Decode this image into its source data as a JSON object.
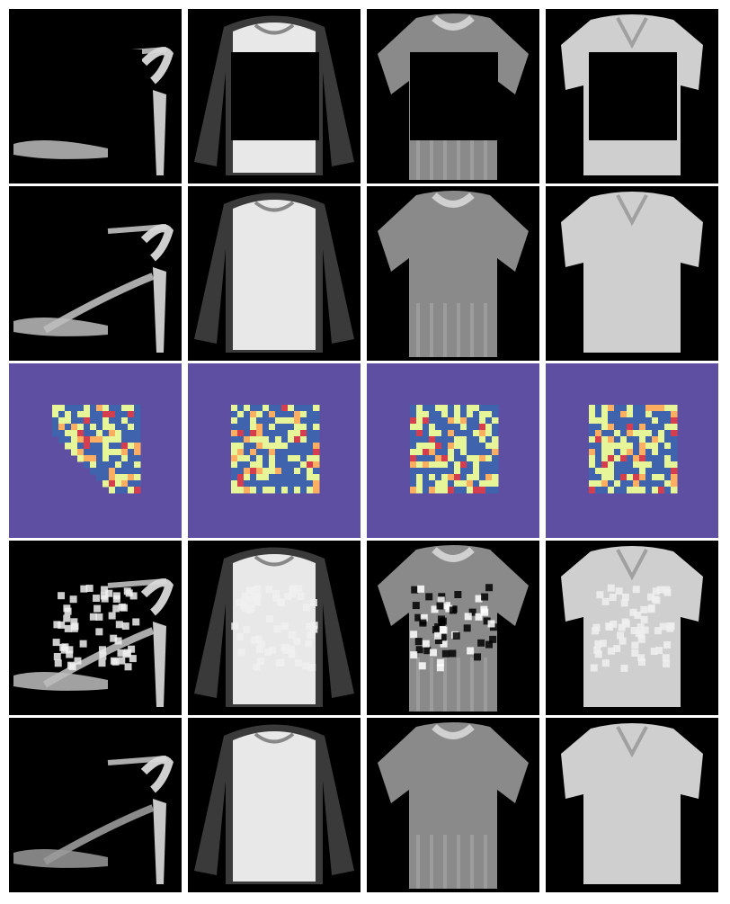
{
  "colors": {
    "background": "#000000",
    "separator": "#ffffff",
    "heatmap_background": "#5e4fa2",
    "heatmap_low": "#3f64ad",
    "heatmap_mid": "#e6f598",
    "heatmap_high": "#d53e4f"
  },
  "grid": {
    "rows": [
      {
        "kind": "masked-input",
        "cells": [
          {
            "subject": "sandal"
          },
          {
            "subject": "long-sleeve-top"
          },
          {
            "subject": "t-shirt"
          },
          {
            "subject": "shirt"
          }
        ]
      },
      {
        "kind": "reconstruction-a",
        "cells": [
          {
            "subject": "sandal"
          },
          {
            "subject": "long-sleeve-top"
          },
          {
            "subject": "t-shirt"
          },
          {
            "subject": "shirt"
          }
        ]
      },
      {
        "kind": "heatmap",
        "cells": [
          {
            "subject": "sandal"
          },
          {
            "subject": "long-sleeve-top"
          },
          {
            "subject": "t-shirt"
          },
          {
            "subject": "shirt"
          }
        ]
      },
      {
        "kind": "reconstruction-b",
        "cells": [
          {
            "subject": "sandal"
          },
          {
            "subject": "long-sleeve-top"
          },
          {
            "subject": "t-shirt"
          },
          {
            "subject": "shirt"
          }
        ]
      },
      {
        "kind": "reconstruction-c",
        "cells": [
          {
            "subject": "sandal"
          },
          {
            "subject": "long-sleeve-top"
          },
          {
            "subject": "t-shirt"
          },
          {
            "subject": "shirt"
          }
        ]
      }
    ]
  }
}
